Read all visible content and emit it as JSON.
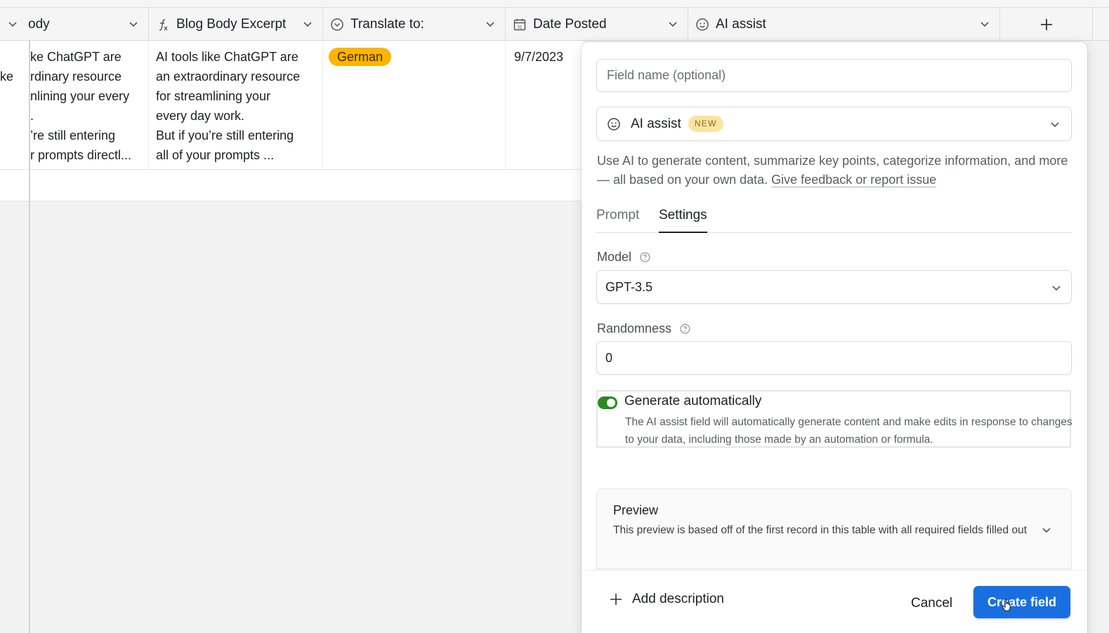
{
  "grid": {
    "columns": [
      {
        "name": "Body",
        "display": "ody",
        "icon": "none"
      },
      {
        "name": "Blog Body Excerpt",
        "display": "Blog Body Excerpt",
        "icon": "formula-icon"
      },
      {
        "name": "Translate to:",
        "display": "Translate to:",
        "icon": "single-select-icon"
      },
      {
        "name": "Date Posted",
        "display": "Date Posted",
        "icon": "calendar-icon"
      },
      {
        "name": "AI assist",
        "display": "AI assist",
        "icon": "ai-assist-icon"
      }
    ],
    "add_column_label": "+",
    "row": {
      "left_fragment": "ke",
      "body_lines": [
        "ke ChatGPT are",
        "rdinary resource",
        "nlining your every",
        ".",
        "’re still entering",
        "r prompts directl..."
      ],
      "excerpt_lines": [
        "AI tools like ChatGPT are",
        "an extraordinary resource",
        "for streamlining your",
        "every day work.",
        "But if you’re still entering",
        "all of your prompts ..."
      ],
      "translate_to": "German",
      "translate_color": "#fcb400",
      "date_posted": "9/7/2023"
    }
  },
  "panel": {
    "field_name_placeholder": "Field name (optional)",
    "field_type": {
      "label": "AI assist",
      "badge": "NEW",
      "icon": "ai-assist-icon"
    },
    "description": "Use AI to generate content, summarize key points, categorize information, and more — all based on your own data.",
    "feedback_link": "Give feedback or report issue",
    "tabs": [
      {
        "label": "Prompt",
        "active": false
      },
      {
        "label": "Settings",
        "active": true
      }
    ],
    "model": {
      "label": "Model",
      "value": "GPT-3.5"
    },
    "randomness": {
      "label": "Randomness",
      "value": "0"
    },
    "generate_automatically": {
      "label": "Generate automatically",
      "enabled": true,
      "description": "The AI assist field will automatically generate content and make edits in response to changes to your data, including those made by an automation or formula.",
      "toggle_color": "#2a8a1e"
    },
    "preview": {
      "title": "Preview",
      "description": "This preview is based off of the first record in this table with all required fields filled out"
    },
    "footer": {
      "add_description": "Add description",
      "cancel": "Cancel",
      "create": "Create field",
      "create_color": "#1a6fe0"
    }
  }
}
